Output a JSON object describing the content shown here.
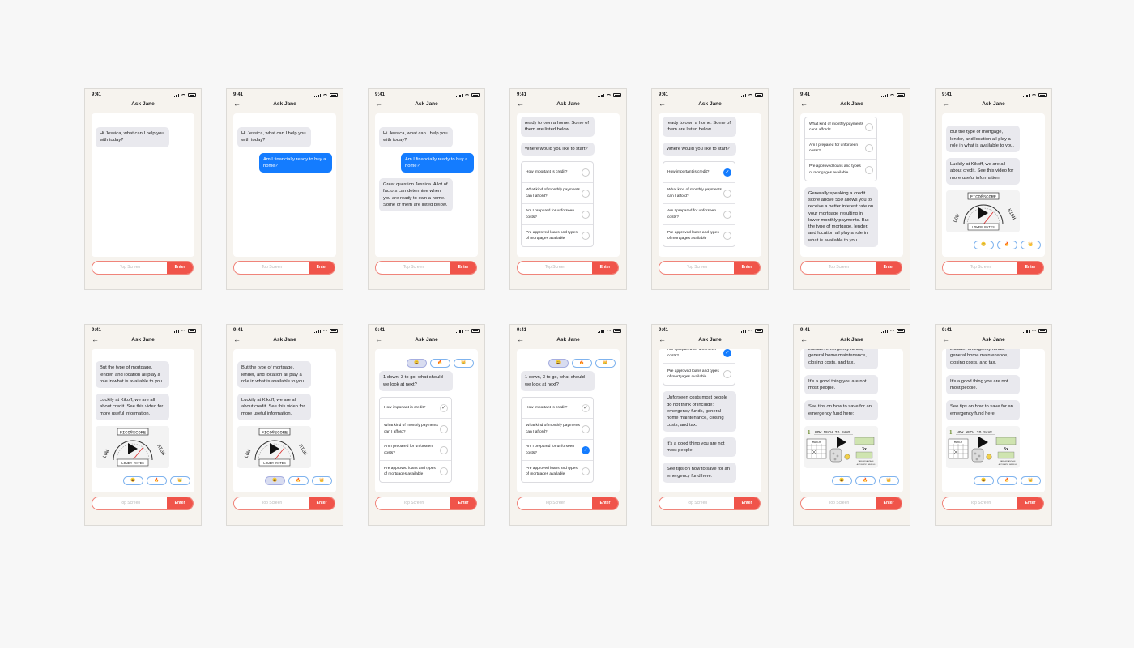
{
  "app": {
    "time": "9:41",
    "title": "Ask Jane",
    "back_icon": "←",
    "placeholder": "Top Screen",
    "enter_label": "Enter"
  },
  "messages": {
    "greeting": "Hi Jessica, what can I help you with today?",
    "user_q": "Am I financially ready to buy a home?",
    "great_q": "Great question Jessica. A lot of factors can determine when you are ready to own a home. Some of them are listed below.",
    "great_q_tail": "ready to own a home. Some of them are listed below.",
    "where_start": "Where would you like to start?",
    "credit_reply": "Generally speaking a credit score above 550 allows you to receive a better interest rate on your mortgage resulting in lower monthly payments. But the type of mortgage, lender, and location all play a role in what is available to you.",
    "credit_tail": "But the type of mortgage, lender, and location all play a role in what is available to you.",
    "kikoff": "Luckily at Kikoff, we are all about credit. See this video for more useful information.",
    "one_down": "1 down, 3 to go, what should we look at next?",
    "unforeseen": "Unforseen costs most people do not think of include: emergency funds, general home maintenance, closing costs, and tax.",
    "good_thing": "It’s a good thing you are not most people.",
    "tips": "See tips on how to save for an emergency fund here:",
    "unforeseen_tail": "include: emergency funds, general home maintenance, closing costs, and tax."
  },
  "choices": [
    "How important is credit?",
    "What kind of monthly payments can I afford?",
    "Am I prepared for unforseen costs?",
    "Pre approved loans and types of mortgages available"
  ],
  "choices_alt": [
    "What kind of monthly payments can I afford?"
  ],
  "reactions": {
    "smile": "😀",
    "fire": "🔥",
    "crown": "👑"
  },
  "selection_marks": {
    "selected": "✓",
    "completed": "✓"
  },
  "video_fico": {
    "title": "FICO®SCORE",
    "low": "LOW",
    "high": "HIGH",
    "caption": "LOWER RATES"
  },
  "video_save": {
    "title": "HOW MUCH TO SAVE",
    "number": "1",
    "month": "MARCH",
    "multiplier": "3x",
    "note1": "TAKE ADVANTAGE",
    "note2": "AUTOMATIC SAVINGS"
  }
}
